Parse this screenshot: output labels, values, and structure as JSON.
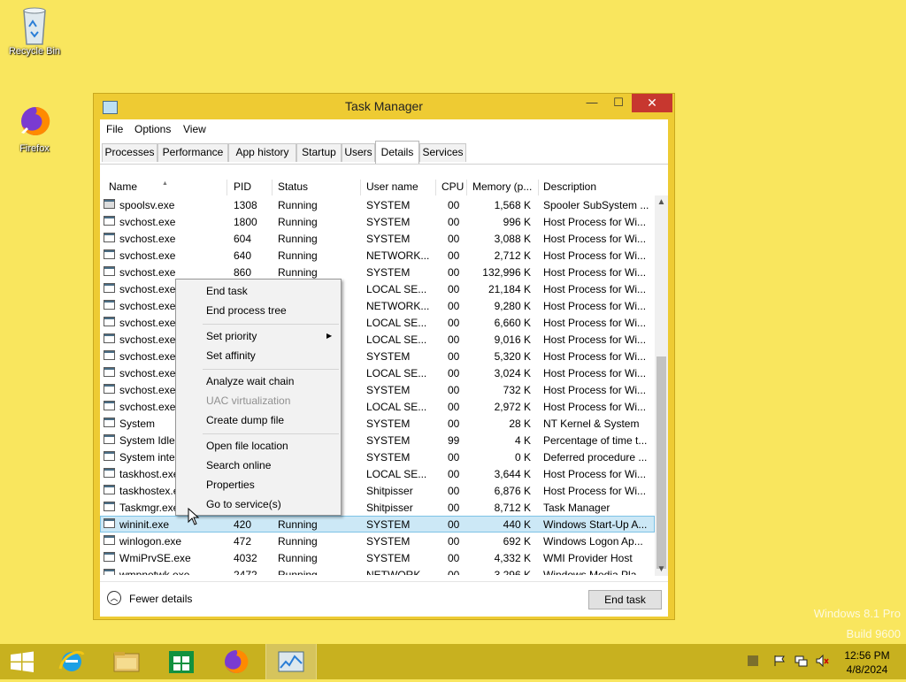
{
  "desktop": {
    "icons": [
      {
        "label": "Recycle Bin",
        "icon": "recycle-bin-icon"
      },
      {
        "label": "Firefox",
        "icon": "firefox-icon"
      }
    ],
    "watermark": {
      "line1": "Windows 8.1 Pro",
      "line2": "Build 9600"
    }
  },
  "window": {
    "title": "Task Manager",
    "controls": {
      "minimize": "—",
      "maximize": "☐",
      "close": "✕"
    },
    "menu": [
      "File",
      "Options",
      "View"
    ],
    "tabs": [
      {
        "label": "Processes"
      },
      {
        "label": "Performance"
      },
      {
        "label": "App history"
      },
      {
        "label": "Startup"
      },
      {
        "label": "Users"
      },
      {
        "label": "Details",
        "active": true
      },
      {
        "label": "Services"
      }
    ],
    "columns": [
      "Name",
      "PID",
      "Status",
      "User name",
      "CPU",
      "Memory (p...",
      "Description"
    ],
    "rows": [
      {
        "name": "spoolsv.exe",
        "pid": "1308",
        "status": "Running",
        "user": "SYSTEM",
        "cpu": "00",
        "mem": "1,568 K",
        "desc": "Spooler SubSystem ...",
        "icon": "printer"
      },
      {
        "name": "svchost.exe",
        "pid": "1800",
        "status": "Running",
        "user": "SYSTEM",
        "cpu": "00",
        "mem": "996 K",
        "desc": "Host Process for Wi..."
      },
      {
        "name": "svchost.exe",
        "pid": "604",
        "status": "Running",
        "user": "SYSTEM",
        "cpu": "00",
        "mem": "3,088 K",
        "desc": "Host Process for Wi..."
      },
      {
        "name": "svchost.exe",
        "pid": "640",
        "status": "Running",
        "user": "NETWORK...",
        "cpu": "00",
        "mem": "2,712 K",
        "desc": "Host Process for Wi..."
      },
      {
        "name": "svchost.exe",
        "pid": "860",
        "status": "Running",
        "user": "SYSTEM",
        "cpu": "00",
        "mem": "132,996 K",
        "desc": "Host Process for Wi..."
      },
      {
        "name": "svchost.exe",
        "pid": "",
        "status": "",
        "user": "LOCAL SE...",
        "cpu": "00",
        "mem": "21,184 K",
        "desc": "Host Process for Wi..."
      },
      {
        "name": "svchost.exe",
        "pid": "",
        "status": "",
        "user": "NETWORK...",
        "cpu": "00",
        "mem": "9,280 K",
        "desc": "Host Process for Wi..."
      },
      {
        "name": "svchost.exe",
        "pid": "",
        "status": "",
        "user": "LOCAL SE...",
        "cpu": "00",
        "mem": "6,660 K",
        "desc": "Host Process for Wi..."
      },
      {
        "name": "svchost.exe",
        "pid": "",
        "status": "",
        "user": "LOCAL SE...",
        "cpu": "00",
        "mem": "9,016 K",
        "desc": "Host Process for Wi..."
      },
      {
        "name": "svchost.exe",
        "pid": "",
        "status": "",
        "user": "SYSTEM",
        "cpu": "00",
        "mem": "5,320 K",
        "desc": "Host Process for Wi..."
      },
      {
        "name": "svchost.exe",
        "pid": "",
        "status": "",
        "user": "LOCAL SE...",
        "cpu": "00",
        "mem": "3,024 K",
        "desc": "Host Process for Wi..."
      },
      {
        "name": "svchost.exe",
        "pid": "",
        "status": "",
        "user": "SYSTEM",
        "cpu": "00",
        "mem": "732 K",
        "desc": "Host Process for Wi..."
      },
      {
        "name": "svchost.exe",
        "pid": "",
        "status": "",
        "user": "LOCAL SE...",
        "cpu": "00",
        "mem": "2,972 K",
        "desc": "Host Process for Wi..."
      },
      {
        "name": "System",
        "pid": "",
        "status": "",
        "user": "SYSTEM",
        "cpu": "00",
        "mem": "28 K",
        "desc": "NT Kernel & System"
      },
      {
        "name": "System Idle",
        "pid": "",
        "status": "",
        "user": "SYSTEM",
        "cpu": "99",
        "mem": "4 K",
        "desc": "Percentage of time t..."
      },
      {
        "name": "System inter",
        "pid": "",
        "status": "",
        "user": "SYSTEM",
        "cpu": "00",
        "mem": "0 K",
        "desc": "Deferred procedure ..."
      },
      {
        "name": "taskhost.exe",
        "pid": "",
        "status": "",
        "user": "LOCAL SE...",
        "cpu": "00",
        "mem": "3,644 K",
        "desc": "Host Process for Wi..."
      },
      {
        "name": "taskhostex.e",
        "pid": "",
        "status": "",
        "user": "Shitpisser",
        "cpu": "00",
        "mem": "6,876 K",
        "desc": "Host Process for Wi..."
      },
      {
        "name": "Taskmgr.exe",
        "pid": "",
        "status": "",
        "user": "Shitpisser",
        "cpu": "00",
        "mem": "8,712 K",
        "desc": "Task Manager",
        "icon": "chart"
      },
      {
        "name": "wininit.exe",
        "pid": "420",
        "status": "Running",
        "user": "SYSTEM",
        "cpu": "00",
        "mem": "440 K",
        "desc": "Windows Start-Up A...",
        "selected": true
      },
      {
        "name": "winlogon.exe",
        "pid": "472",
        "status": "Running",
        "user": "SYSTEM",
        "cpu": "00",
        "mem": "692 K",
        "desc": "Windows Logon Ap..."
      },
      {
        "name": "WmiPrvSE.exe",
        "pid": "4032",
        "status": "Running",
        "user": "SYSTEM",
        "cpu": "00",
        "mem": "4,332 K",
        "desc": "WMI Provider Host"
      },
      {
        "name": "wmpnetwk.exe",
        "pid": "2472",
        "status": "Running",
        "user": "NETWORK...",
        "cpu": "00",
        "mem": "3,296 K",
        "desc": "Windows Media Pla..."
      }
    ],
    "footer": {
      "fewer_details": "Fewer details",
      "end_task": "End task"
    }
  },
  "context_menu": {
    "items": [
      {
        "label": "End task"
      },
      {
        "label": "End process tree"
      },
      {
        "label": "Set priority",
        "submenu": true
      },
      {
        "label": "Set affinity"
      },
      {
        "label": "Analyze wait chain"
      },
      {
        "label": "UAC virtualization",
        "disabled": true
      },
      {
        "label": "Create dump file"
      },
      {
        "label": "Open file location"
      },
      {
        "label": "Search online"
      },
      {
        "label": "Properties"
      },
      {
        "label": "Go to service(s)"
      }
    ]
  },
  "taskbar": {
    "items": [
      "start-button",
      "internet-explorer-icon",
      "file-explorer-icon",
      "store-icon",
      "firefox-icon",
      "task-manager-icon"
    ],
    "clock": {
      "time": "12:56 PM",
      "date": "4/8/2024"
    }
  },
  "colors": {
    "desktop": "#f9e65e",
    "window_frame": "#eecb33",
    "close": "#c7372f",
    "taskbar": "#c8b11f",
    "selection": "#cce8f6"
  }
}
